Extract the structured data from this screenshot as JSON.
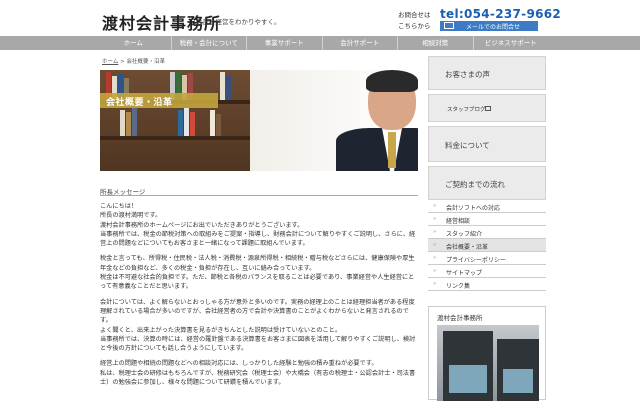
{
  "header": {
    "logo_title": "渡村会計事務所",
    "tagline": "会計と経営をわかりやすく。",
    "contact_label_line1": "お問合せは",
    "contact_label_line2": "こちらから",
    "phone": "tel:054-237-9662",
    "mail_button": "メールでのお問合せ"
  },
  "nav": {
    "items": [
      "ホーム",
      "税務・会計について",
      "事業サポート",
      "会計サポート",
      "相続対策",
      "ビジネスサポート"
    ]
  },
  "breadcrumb": {
    "home": "ホーム",
    "separator": ">",
    "current": "会社概要・沿革"
  },
  "hero": {
    "title": "会社概要・沿革"
  },
  "main": {
    "section_heading": "所長メッセージ",
    "paragraphs": [
      "こんにちは！\n所長の渡村満明です。\n渡村会計事務所のホームページにお出でいただきありがとうございます。\n当事務所では、税金の節税対策への取組みをご提案・指導し、財務会計について解りやすくご説明し、さらに、経営上の問題などについてもお客さまと一緒になって課題に取組んでいます。",
      "税金と言っても、所得税・住民税・法人税・消費税・源泉所得税・相続税・贈与税などさらには、健康保険や厚生年金などの負担など、多くの税金・負担が存在し、互いに絡み合っています。\n税金は不可避な社会的負担です。ただ、節税と各税のバランスを取ることは必要であり、事業経営や人生経営にとって有意義なことだと思います。",
      "会計については、よく解らないとおっしゃる方が意外と多いのです。実務の経理上のことは経理担当者がある程度理解されている場合が多いのですが、会社経営者の方で会計や決算書のことがよくわからないと発言されるのです。\nよく聞くと、出来上がった決算書を見るがきちんとした説明は受けていないとのこと。\n当事務所では、決算の時には、経営の羅針盤である決算書をお客さまに図表を活用して解りやすくご説明し、検討と今後の方針についても話し合うようにしています。",
      "経営上の問題や相続の問題などへの相談対応には、しっかりした経験と勉強の積み重ねが必要です。\n私は、税理士会の研修はもちろんですが、税務研究会（税理士会）や大橋会（有志の税理士・公認会計士・司法書士）の勉強会に参加し、様々な問題について研鑽を積んでいます。"
    ]
  },
  "sidebar": {
    "boxes": [
      "お客さまの声",
      "料金について",
      "ご契約までの流れ"
    ],
    "staff_blog": "スタッフブログ",
    "menu": [
      {
        "label": "会計ソフトへの対応",
        "active": false
      },
      {
        "label": "経営相談",
        "active": false
      },
      {
        "label": "スタッフ紹介",
        "active": false
      },
      {
        "label": "会社概要・沿革",
        "active": true
      },
      {
        "label": "プライバシーポリシー",
        "active": false
      },
      {
        "label": "サイトマップ",
        "active": false
      },
      {
        "label": "リンク集",
        "active": false
      }
    ],
    "office_title": "渡村会計事務所"
  },
  "colors": {
    "phone": "#1a5fb4",
    "nav_bg": "#a8a8a8",
    "hero_banner": "#c3a53c",
    "sidebar_bg": "#ebebeb"
  }
}
